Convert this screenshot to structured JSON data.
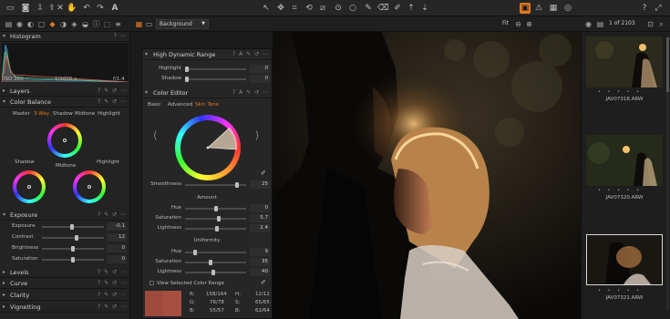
{
  "toolbar": {
    "left_icons": [
      "folder-icon",
      "camera-icon",
      "import-icon",
      "export-icon",
      "delete-icon",
      "hand-icon",
      "undo-icon",
      "redo-icon",
      "text-icon"
    ],
    "center_icons": [
      "cursor-icon",
      "pan-icon",
      "crop-icon",
      "rotate-icon",
      "keystone-icon",
      "spot-icon",
      "circle-icon",
      "brush-icon",
      "eraser-icon",
      "picker-icon",
      "copy-icon",
      "paste-icon"
    ],
    "right_icons": [
      "compare-icon",
      "exposure-warning-icon",
      "grid-icon",
      "glasses-icon",
      "help-icon"
    ]
  },
  "subbar": {
    "background_select": "Background",
    "zoom_label": "Fit",
    "counter": "1 of 2103"
  },
  "left_panel": {
    "histogram": {
      "title": "Histogram",
      "iso": "ISO 100",
      "shutter": "1/1000 s",
      "aperture": "f/1.4"
    },
    "layers_title": "Layers",
    "color_balance": {
      "title": "Color Balance",
      "tabs": [
        "Master",
        "3-Way",
        "Shadow",
        "Midtone",
        "Highlight"
      ],
      "active_tab": "3-Way",
      "labels": {
        "shadow": "Shadow",
        "midtone": "Midtone",
        "highlight": "Highlight"
      }
    },
    "exposure": {
      "title": "Exposure",
      "sliders": [
        {
          "label": "Exposure",
          "value": "-0.1",
          "pos": 0.48
        },
        {
          "label": "Contrast",
          "value": "12",
          "pos": 0.56
        },
        {
          "label": "Brightness",
          "value": "0",
          "pos": 0.5
        },
        {
          "label": "Saturation",
          "value": "0",
          "pos": 0.5
        }
      ]
    },
    "collapsed_tools": [
      "Levels",
      "Curve",
      "Clarity",
      "Vignetting"
    ]
  },
  "float_panel": {
    "hdr": {
      "title": "High Dynamic Range",
      "sliders": [
        {
          "label": "Highlight",
          "value": "0",
          "pos": 0.0
        },
        {
          "label": "Shadow",
          "value": "0",
          "pos": 0.0
        }
      ]
    },
    "color_editor": {
      "title": "Color Editor",
      "tabs": [
        "Basic",
        "Advanced",
        "Skin Tone"
      ],
      "active_tab": "Skin Tone",
      "smoothness": {
        "label": "Smoothness",
        "value": "25",
        "pos": 0.88
      },
      "amount_label": "Amount",
      "amount": [
        {
          "label": "Hue",
          "value": "0",
          "pos": 0.5
        },
        {
          "label": "Saturation",
          "value": "5.7",
          "pos": 0.55
        },
        {
          "label": "Lightness",
          "value": "2.4",
          "pos": 0.53
        }
      ],
      "uniformity_label": "Uniformity",
      "uniformity": [
        {
          "label": "Hue",
          "value": "9",
          "pos": 0.14
        },
        {
          "label": "Saturation",
          "value": "35",
          "pos": 0.42
        },
        {
          "label": "Lightness",
          "value": "40",
          "pos": 0.46
        }
      ],
      "view_selected": "View Selected Color Range",
      "readout": {
        "r": "R:",
        "r_val": "158/164",
        "g": "G:",
        "g_val": "76/78",
        "b": "B:",
        "b_val": "55/57",
        "h": "H:",
        "h_val": "12/12",
        "s": "S:",
        "s_val": "65/65",
        "bb": "B:",
        "bb_val": "62/64"
      }
    }
  },
  "filmstrip": {
    "items": [
      {
        "name": "JAV07318.ARW",
        "selected": false
      },
      {
        "name": "JAV07320.ARW",
        "selected": false
      },
      {
        "name": "JAV07321.ARW",
        "selected": true
      }
    ],
    "rating_dots": "• • • • •"
  }
}
